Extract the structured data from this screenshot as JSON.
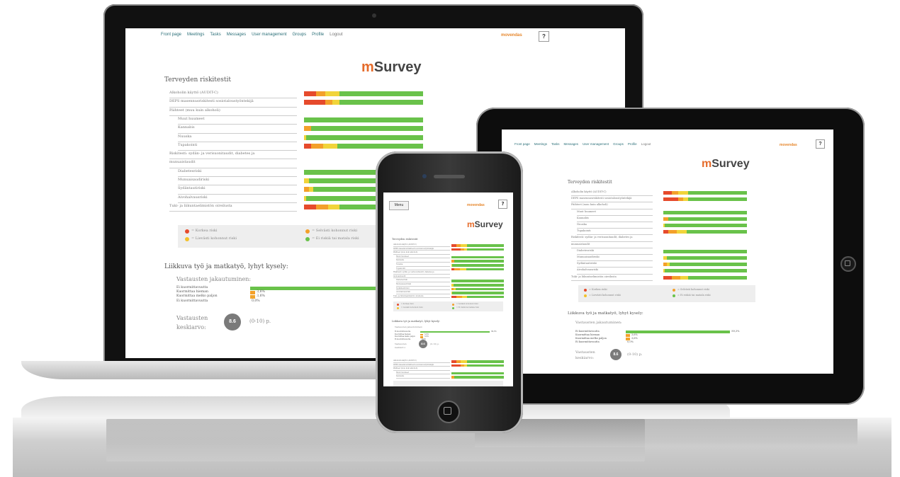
{
  "nav": {
    "items": [
      "Front page",
      "Meetings",
      "Tasks",
      "Messages",
      "User management",
      "Groups",
      "Profile",
      "Logout"
    ],
    "company": "movendas",
    "help": "?"
  },
  "brand": {
    "m": "m",
    "rest": "Survey"
  },
  "section1": {
    "title": "Terveyden riskitestit",
    "rows": [
      {
        "label": "Alkoholin käyttö (AUDIT-C)",
        "segs": [
          [
            "r",
            10
          ],
          [
            "o",
            8
          ],
          [
            "y",
            12
          ],
          [
            "g",
            70
          ]
        ]
      },
      {
        "label": "DEPS masennusriskitesti sosiotaloustyöntekijä",
        "segs": [
          [
            "r",
            18
          ],
          [
            "o",
            6
          ],
          [
            "y",
            6
          ],
          [
            "g",
            70
          ]
        ]
      },
      {
        "label": "Päihteet (muu kuin alkoholi)",
        "segs": []
      },
      {
        "label": "Muut huumeet",
        "segs": [
          [
            "g",
            100
          ]
        ]
      },
      {
        "label": "Kannabis",
        "segs": [
          [
            "o",
            6
          ],
          [
            "g",
            94
          ]
        ]
      },
      {
        "label": "Nuuska",
        "segs": [
          [
            "y",
            2
          ],
          [
            "g",
            98
          ]
        ]
      },
      {
        "label": "Tupakointi",
        "segs": [
          [
            "r",
            6
          ],
          [
            "o",
            10
          ],
          [
            "y",
            12
          ],
          [
            "g",
            72
          ]
        ]
      },
      {
        "label": "Riskitesti: sydän- ja verisuonitaudit, diabetes ja",
        "segs": []
      },
      {
        "label": "munuaistaudit",
        "segs": []
      },
      {
        "label": "Diabetesriski",
        "segs": [
          [
            "g",
            100
          ]
        ]
      },
      {
        "label": "Munuaisaudiriski",
        "segs": [
          [
            "y",
            4
          ],
          [
            "g",
            96
          ]
        ]
      },
      {
        "label": "Sydäntautiriski",
        "segs": [
          [
            "o",
            4
          ],
          [
            "y",
            4
          ],
          [
            "g",
            92
          ]
        ]
      },
      {
        "label": "Aivohalvausriski",
        "segs": [
          [
            "y",
            2
          ],
          [
            "g",
            98
          ]
        ]
      },
      {
        "label": "Tuki- ja liikuntaelimistön oireilusta",
        "segs": [
          [
            "r",
            10
          ],
          [
            "o",
            10
          ],
          [
            "y",
            10
          ],
          [
            "g",
            70
          ]
        ]
      }
    ],
    "legend": [
      {
        "color": "#e64a2c",
        "text": "= Korkea riski"
      },
      {
        "color": "#f3c12a",
        "text": "= Lievästi kohonnut riski"
      },
      {
        "color": "#f3a02a",
        "text": "= Selvästi kohonnut riski"
      },
      {
        "color": "#69c24a",
        "text": "= Ei riskiä tai matala riski"
      }
    ]
  },
  "section2": {
    "title": "Liikkuva työ ja matkatyö, lyhyt kysely:",
    "subtitle": "Vastausten jakautuminen:",
    "rows": [
      {
        "label": "Ei kuormittavuutta",
        "value": 0.893,
        "color": "#69c24a",
        "text": "89,3%"
      },
      {
        "label": "Kuormittaa hieman",
        "value": 0.036,
        "color": "#f3a02a",
        "text": "3,6%"
      },
      {
        "label": "Kuormittaa melko paljon",
        "value": 0.036,
        "color": "#f1a52e",
        "text": "3,6%"
      },
      {
        "label": "Ei kuormittavuutta",
        "value": 0.0,
        "color": "#e64a2c",
        "text": "0,0%"
      }
    ],
    "avg_label_1": "Vastausten",
    "avg_label_2": "keskiarvo:",
    "avg_value": "8.6",
    "avg_scale": "(0-10) p."
  },
  "phone": {
    "menu": "Menu"
  }
}
